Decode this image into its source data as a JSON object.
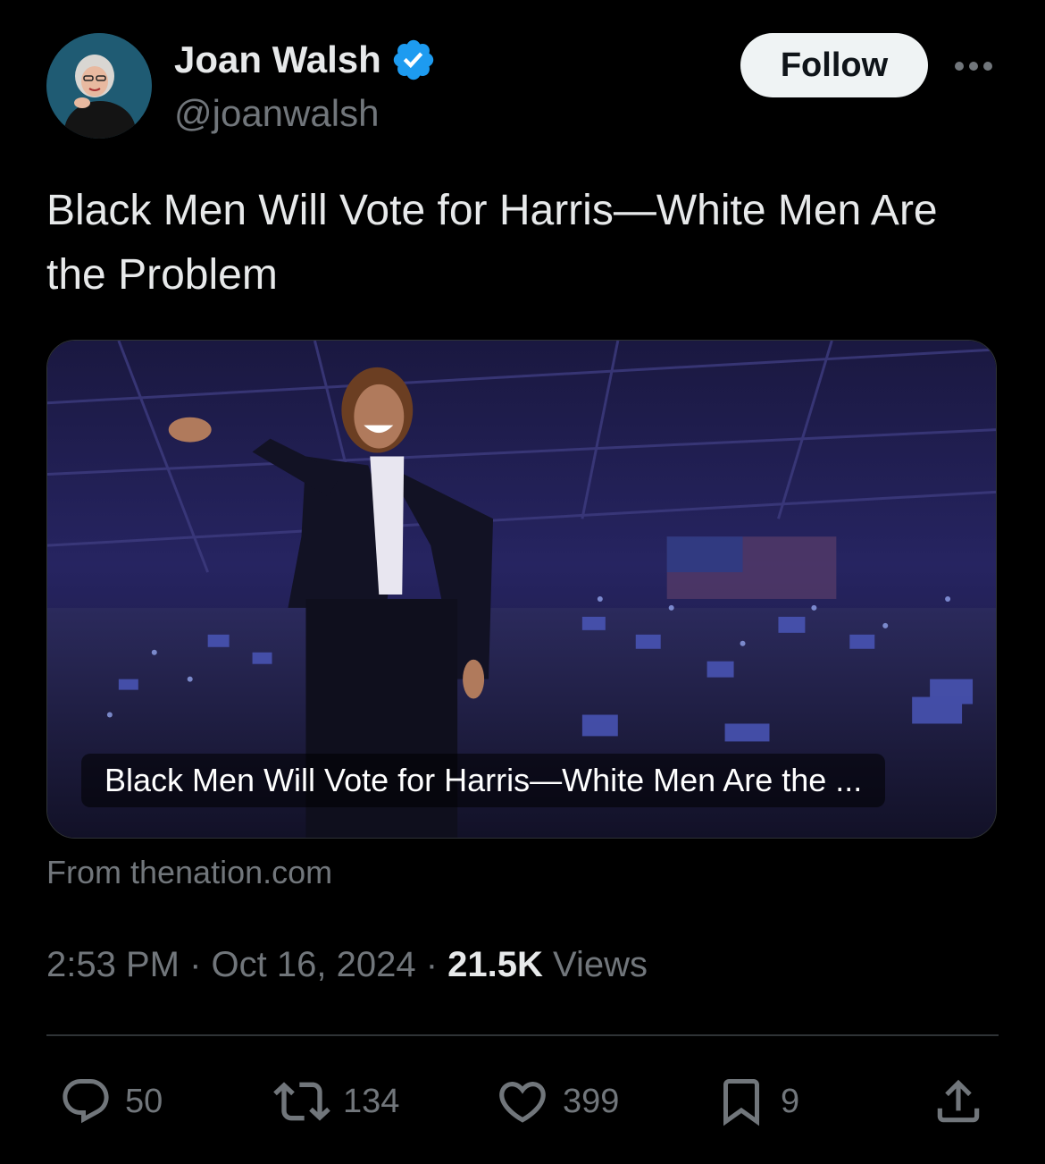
{
  "author": {
    "name": "Joan Walsh",
    "handle": "@joanwalsh"
  },
  "header": {
    "follow_label": "Follow"
  },
  "tweet": {
    "text": "Black Men Will Vote for Harris—White Men Are the Problem"
  },
  "link_card": {
    "caption": "Black Men Will Vote for Harris—White Men Are the ...",
    "source": "From thenation.com"
  },
  "meta": {
    "time": "2:53 PM",
    "date": "Oct 16, 2024",
    "views_count": "21.5K",
    "views_label": "Views"
  },
  "actions": {
    "replies": "50",
    "reposts": "134",
    "likes": "399",
    "bookmarks": "9"
  },
  "icons": [
    "verified-badge-icon",
    "more-icon",
    "reply-icon",
    "repost-icon",
    "like-icon",
    "bookmark-icon",
    "share-icon"
  ],
  "colors": {
    "background": "#000000",
    "text_primary": "#e7e9ea",
    "text_secondary": "#71767b",
    "verified_blue": "#1d9bf0",
    "follow_bg": "#eff3f4"
  }
}
